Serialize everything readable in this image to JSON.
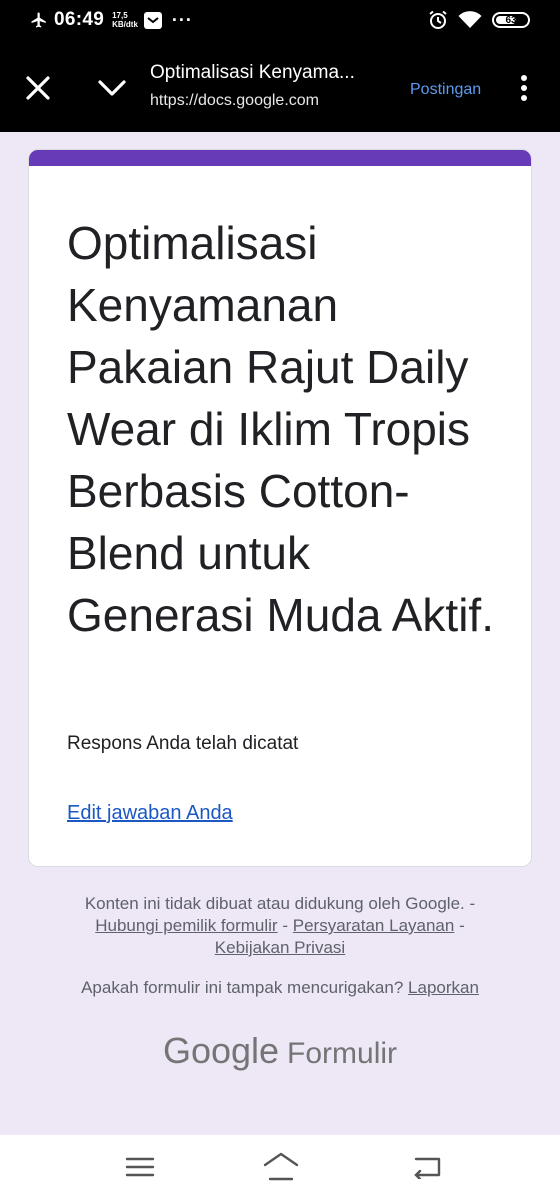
{
  "status_bar": {
    "time": "06:49",
    "speed_value": "17,5",
    "speed_unit": "KB/dtk",
    "more": "···",
    "battery_level": "63",
    "icons": [
      "airplane-icon",
      "message-icon",
      "alarm-icon",
      "wifi-icon",
      "battery-icon"
    ]
  },
  "browser": {
    "page_title": "Optimalisasi Kenyama...",
    "url": "https://docs.google.com",
    "post_button": "Postingan",
    "icons": [
      "close-icon",
      "chevron-down-icon",
      "more-vert-icon"
    ]
  },
  "form": {
    "accent_color": "#673ab7",
    "title": "Optimalisasi Kenyamanan Pakaian Rajut Daily Wear di Iklim Tropis Berbasis Cotton-Blend untuk Generasi Muda Aktif.",
    "response_message": "Respons Anda telah dicatat",
    "edit_link": "Edit jawaban Anda"
  },
  "footer": {
    "disclaimer": "Konten ini tidak dibuat atau didukung oleh Google.",
    "sep": "-",
    "contact_owner": "Hubungi pemilik formulir",
    "terms": "Persyaratan Layanan",
    "privacy": "Kebijakan Privasi",
    "suspicious_question": "Apakah formulir ini tampak mencurigakan?",
    "report": "Laporkan",
    "brand_google": "Google",
    "brand_forms": "Formulir"
  },
  "nav": {
    "icons": [
      "menu-icon",
      "home-icon",
      "back-icon"
    ]
  }
}
